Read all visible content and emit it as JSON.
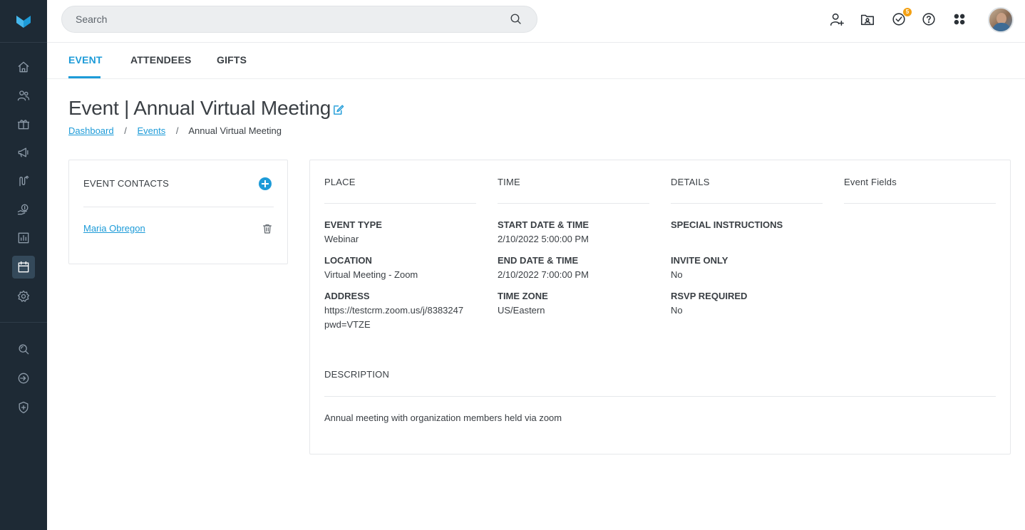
{
  "colors": {
    "accent": "#1d9bd8",
    "sidebar": "#1e2a35",
    "badge": "#f3a012"
  },
  "sidebar": {
    "logo": "brand-logo",
    "items": [
      {
        "icon": "home-icon"
      },
      {
        "icon": "people-icon"
      },
      {
        "icon": "gift-icon"
      },
      {
        "icon": "megaphone-icon"
      },
      {
        "icon": "route-icon"
      },
      {
        "icon": "donation-icon"
      },
      {
        "icon": "reports-icon"
      },
      {
        "icon": "calendar-icon",
        "active": true
      },
      {
        "icon": "settings-icon"
      },
      {
        "icon": "search-records-icon"
      },
      {
        "icon": "login-icon"
      },
      {
        "icon": "shield-plus-icon"
      }
    ]
  },
  "search": {
    "placeholder": "Search"
  },
  "header_icons": {
    "add_user": "add-user-icon",
    "folder": "folder-contact-icon",
    "tasks": "tasks-check-icon",
    "tasks_badge": "5",
    "help": "help-icon",
    "apps": "apps-grid-icon",
    "avatar": "user-avatar"
  },
  "tabs": [
    {
      "label": "EVENT",
      "active": true
    },
    {
      "label": "ATTENDEES"
    },
    {
      "label": "GIFTS"
    }
  ],
  "page": {
    "title": "Event | Annual Virtual Meeting",
    "breadcrumb": {
      "dashboard": "Dashboard",
      "events": "Events",
      "current": "Annual Virtual Meeting",
      "separator": "/"
    }
  },
  "contacts": {
    "title": "EVENT CONTACTS",
    "items": [
      {
        "name": "Maria Obregon"
      }
    ]
  },
  "details": {
    "columns": {
      "place": "PLACE",
      "time": "TIME",
      "details": "DETAILS",
      "event_fields": "Event Fields"
    },
    "place": {
      "event_type_label": "EVENT TYPE",
      "event_type": "Webinar",
      "location_label": "LOCATION",
      "location": "Virtual Meeting - Zoom",
      "address_label": "ADDRESS",
      "address_line1": "https://testcrm.zoom.us/j/8383247",
      "address_line2": "pwd=VTZE"
    },
    "time": {
      "start_label": "START DATE & TIME",
      "start": "2/10/2022 5:00:00 PM",
      "end_label": "END DATE & TIME",
      "end": "2/10/2022 7:00:00 PM",
      "tz_label": "TIME ZONE",
      "tz": "US/Eastern"
    },
    "info": {
      "special_label": "SPECIAL INSTRUCTIONS",
      "invite_label": "INVITE ONLY",
      "invite": "No",
      "rsvp_label": "RSVP REQUIRED",
      "rsvp": "No"
    },
    "description": {
      "label": "DESCRIPTION",
      "text": "Annual meeting with organization members held via zoom"
    }
  }
}
